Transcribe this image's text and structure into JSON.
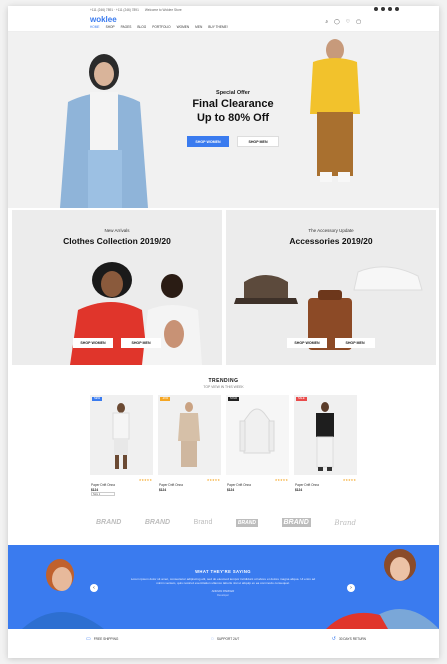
{
  "topbar": {
    "phone": "+111 (246) 7891 · +111 (246) 7891",
    "hours": "Welcome to Woklee Store"
  },
  "header": {
    "logo": "woklee",
    "nav": [
      "HOME",
      "SHOP",
      "PAGES",
      "BLOG",
      "PORTFOLIO",
      "WOMEN",
      "MEN",
      "BUY THEME!"
    ],
    "icons": [
      "search-icon",
      "user-icon",
      "wishlist-icon",
      "cart-icon"
    ]
  },
  "hero": {
    "subtitle": "Special Offer",
    "title_line1": "Final Clearance",
    "title_line2": "Up to 80% Off",
    "btn_women": "SHOP WOMEN",
    "btn_men": "SHOP MEN"
  },
  "categories": [
    {
      "subtitle": "New Arrivals",
      "title": "Clothes Collection 2019/20",
      "btn_women": "SHOP WOMEN",
      "btn_men": "SHOP MEN"
    },
    {
      "subtitle": "The Accessory Update",
      "title": "Accessories 2019/20",
      "btn_women": "SHOP WOMEN",
      "btn_men": "SHOP MEN"
    }
  ],
  "trending": {
    "title": "TRENDING",
    "subtitle": "TOP VIEW IN THIS WEEK",
    "products": [
      {
        "badge": "NEW",
        "badge_color": "#3a7bef",
        "name": "Paper Drift Onna",
        "price": "$124",
        "stars": "★★★★★",
        "select": "Size 1"
      },
      {
        "badge": "-21%",
        "badge_color": "#f5a623",
        "name": "Paper Drift Onna",
        "price": "$124",
        "stars": "★★★★★"
      },
      {
        "badge": "SOLD",
        "badge_color": "#222222",
        "name": "Paper Drift Onna",
        "price": "$124",
        "stars": "★★★★★"
      },
      {
        "badge": "SALE",
        "badge_color": "#e94b4b",
        "name": "Paper Drift Onna",
        "price": "$124",
        "stars": "★★★★★"
      }
    ]
  },
  "brands": [
    "BRAND",
    "BRAND",
    "Brand",
    "BRAND",
    "BRAND",
    "Brand"
  ],
  "testimonial": {
    "title": "WHAT THEY'RE SAYING",
    "body": "Lorem ipsum dolor sit amet, consectetur adipiscing elit, sed do eiusmod tempor incididunt ut labore et dolore magna aliqua. Ut enim ad minim veniam, quis nostrud exercitation ullamco laboris nisi ut aliquip ex ea commodo consequat.",
    "name": "ADRIAN PARKER",
    "role": "Developer"
  },
  "services": [
    "FREE SHIPPING",
    "SUPPORT 24/7",
    "30 DAYS RETURN"
  ],
  "colors": {
    "accent": "#3a7bef"
  }
}
